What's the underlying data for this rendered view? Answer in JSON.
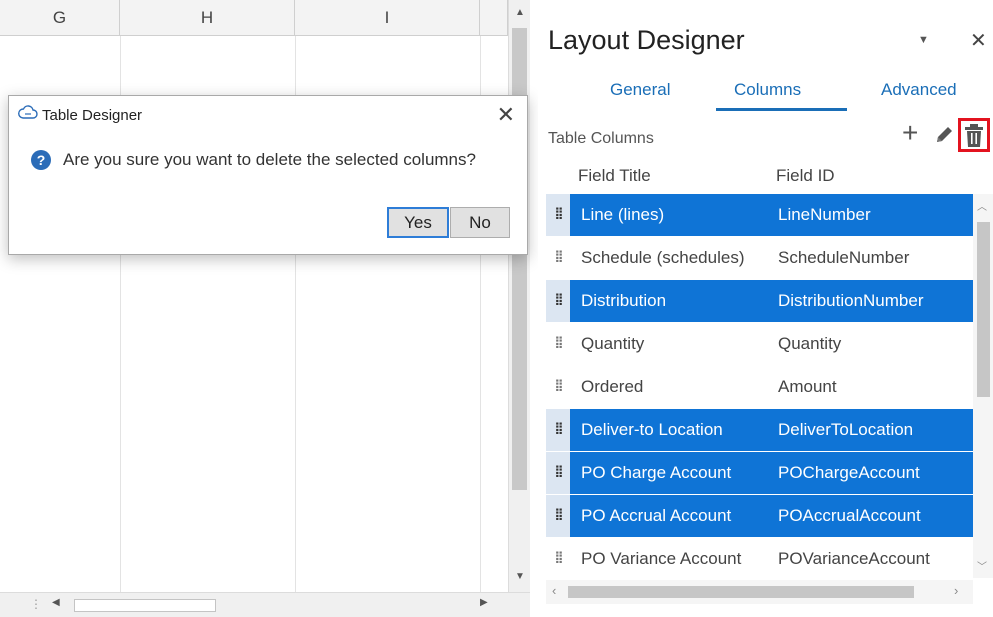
{
  "spreadsheet": {
    "columns": [
      "G",
      "H",
      "I"
    ]
  },
  "dialog": {
    "title": "Table Designer",
    "message": "Are you sure you want to delete the selected columns?",
    "yes_label": "Yes",
    "no_label": "No",
    "close_glyph": "✕"
  },
  "panel": {
    "title": "Layout Designer",
    "dropdown_glyph": "▼",
    "close_glyph": "✕",
    "tabs": [
      {
        "label": "General",
        "active": false
      },
      {
        "label": "Columns",
        "active": true
      },
      {
        "label": "Advanced",
        "active": false
      }
    ],
    "section_label": "Table Columns",
    "tool_add_glyph": "+",
    "headers": {
      "field_title": "Field Title",
      "field_id": "Field ID"
    },
    "rows": [
      {
        "title": "Line (lines)",
        "id": "LineNumber",
        "selected": true
      },
      {
        "title": "Schedule (schedules)",
        "id": "ScheduleNumber",
        "selected": false
      },
      {
        "title": "Distribution",
        "id": "DistributionNumber",
        "selected": true
      },
      {
        "title": "Quantity",
        "id": "Quantity",
        "selected": false
      },
      {
        "title": "Ordered",
        "id": "Amount",
        "selected": false
      },
      {
        "title": "Deliver-to Location",
        "id": "DeliverToLocation",
        "selected": true
      },
      {
        "title": "PO Charge Account",
        "id": "POChargeAccount",
        "selected": true
      },
      {
        "title": "PO Accrual Account",
        "id": "POAccrualAccount",
        "selected": true
      },
      {
        "title": "PO Variance Account",
        "id": "POVarianceAccount",
        "selected": false
      }
    ]
  },
  "icons": {
    "dialog_app": "cloud-app-icon",
    "question": "question-icon",
    "add": "plus-icon",
    "edit": "pencil-icon",
    "delete": "trash-icon",
    "drag": "drag-handle-icon"
  },
  "colors": {
    "accent": "#1a6eb7",
    "selected_row": "#0f74d6",
    "delete_highlight": "#e3131f"
  }
}
